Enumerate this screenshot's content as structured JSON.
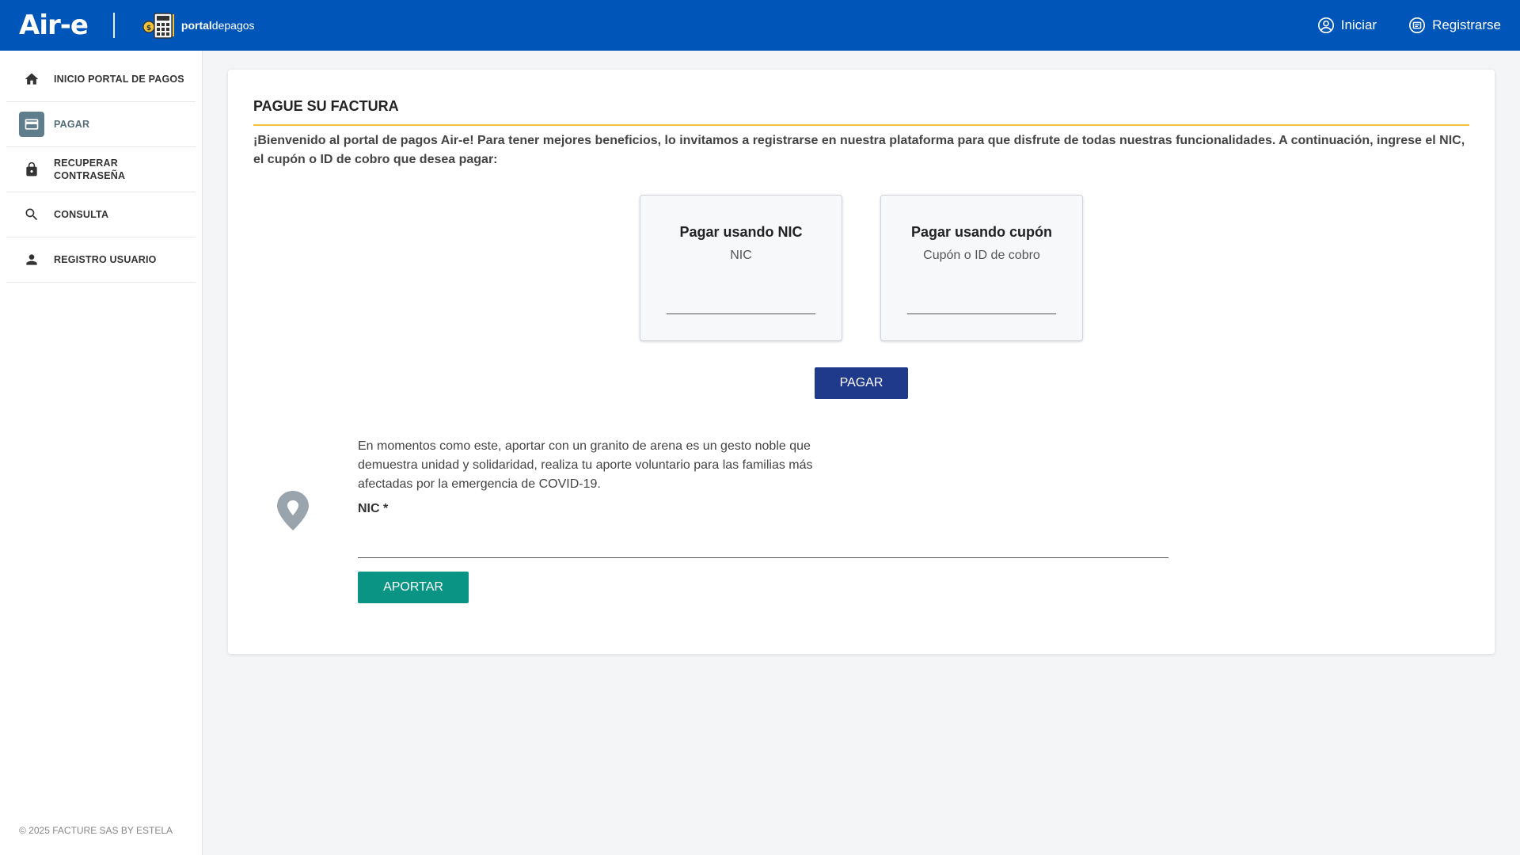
{
  "header": {
    "brand": "Air-e",
    "portal_bold": "portal",
    "portal_rest": "depagos",
    "nav": [
      {
        "label": "Iniciar",
        "icon": "user-circle-icon"
      },
      {
        "label": "Registrarse",
        "icon": "register-icon"
      }
    ],
    "brand_color": "#0055b8"
  },
  "sidebar": {
    "items": [
      {
        "label": "INICIO PORTAL DE PAGOS",
        "icon": "home-icon",
        "active": false
      },
      {
        "label": "PAGAR",
        "icon": "credit-card-icon",
        "active": true
      },
      {
        "label": "RECUPERAR CONTRASEÑA",
        "icon": "lock-icon",
        "active": false
      },
      {
        "label": "CONSULTA",
        "icon": "search-icon",
        "active": false
      },
      {
        "label": "REGISTRO USUARIO",
        "icon": "person-icon",
        "active": false
      }
    ],
    "footer": "© 2025 FACTURE SAS BY ESTELA"
  },
  "main": {
    "title": "PAGUE SU FACTURA",
    "welcome": "¡Bienvenido al portal de pagos Air-e! Para tener mejores beneficios, lo invitamos a registrarse en nuestra plataforma para que disfrute de todas nuestras funcionalidades. A continuación, ingrese el NIC, el cupón o ID de cobro que desea pagar:",
    "option_nic": {
      "title": "Pagar usando NIC",
      "subtitle": "NIC",
      "value": ""
    },
    "option_coupon": {
      "title": "Pagar usando cupón",
      "subtitle": "Cupón o ID de cobro",
      "value": ""
    },
    "pay_button": "PAGAR",
    "donation": {
      "text": "En momentos como este, aportar con un granito de arena es un gesto noble que demuestra unidad y solidaridad, realiza tu aporte voluntario para las familias más afectadas por la emergencia de COVID-19.",
      "nic_label": "NIC *",
      "nic_value": "",
      "button": "APORTAR"
    },
    "accent_color": "#f0c43a",
    "pay_button_color": "#1f3a8a",
    "donate_button_color": "#0a9484"
  }
}
